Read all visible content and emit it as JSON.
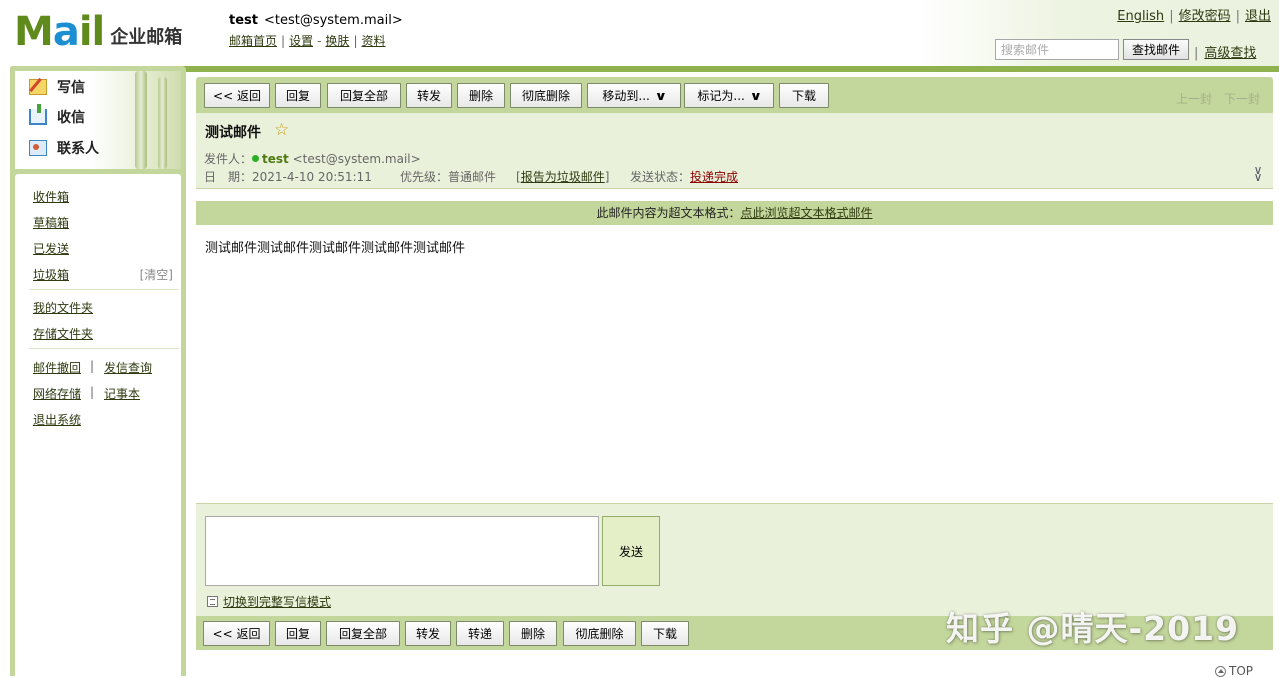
{
  "header": {
    "logo_text_m": "M",
    "logo_text_a": "a",
    "logo_text_il": "il",
    "logo_cn": "企业邮箱",
    "user_name": "test",
    "user_addr": "<test@system.mail>",
    "nav": [
      "邮箱首页",
      "设置",
      "换肤",
      "资料"
    ],
    "top_links": [
      "English",
      "修改密码",
      "退出"
    ],
    "search_placeholder": "搜索邮件",
    "search_button": "查找邮件",
    "advanced_search": "高级查找"
  },
  "sidebar": {
    "quick": [
      {
        "label": "写信",
        "icon": "write-icon"
      },
      {
        "label": "收信",
        "icon": "inbox-icon"
      },
      {
        "label": "联系人",
        "icon": "contacts-icon"
      }
    ],
    "folders": [
      "收件箱",
      "草稿箱",
      "已发送",
      "垃圾箱"
    ],
    "clear_label": "[清空]",
    "my_folders": [
      "我的文件夹",
      "存储文件夹"
    ],
    "tools": [
      "邮件撤回",
      "发信查询",
      "网络存储",
      "记事本",
      "退出系统"
    ]
  },
  "toolbar": {
    "top_buttons": [
      "<< 返回",
      "回复",
      "回复全部",
      "转发",
      "删除",
      "彻底删除",
      "移动到...",
      "标记为...",
      "下载"
    ],
    "bottom_buttons": [
      "<< 返回",
      "回复",
      "回复全部",
      "转发",
      "转递",
      "删除",
      "彻底删除",
      "下载"
    ],
    "prev": "上一封",
    "next": "下一封"
  },
  "message": {
    "subject": "测试邮件",
    "sender_label": "发件人：",
    "sender_name": "test",
    "sender_addr": "<test@system.mail>",
    "date_label": "日　期：",
    "date": "2021-4-10 20:51:11",
    "priority_label": "优先级：",
    "priority": "普通邮件",
    "report_spam": "报告为垃圾邮件",
    "status_label": "发送状态：",
    "status": "投递完成",
    "html_notice": "此邮件内容为超文本格式：",
    "html_notice_link": "点此浏览超文本格式邮件",
    "body": "测试邮件测试邮件测试邮件测试邮件测试邮件"
  },
  "reply": {
    "send": "发送",
    "switch_mode": "切换到完整写信模式"
  },
  "footer": {
    "watermark": "知乎 @晴天-2019",
    "top": "TOP"
  },
  "colors": {
    "accent": "#8fb14e",
    "toolbar_bg": "#c3d69c",
    "panel_bg": "#eaf1db",
    "status_link": "#8b0000"
  }
}
